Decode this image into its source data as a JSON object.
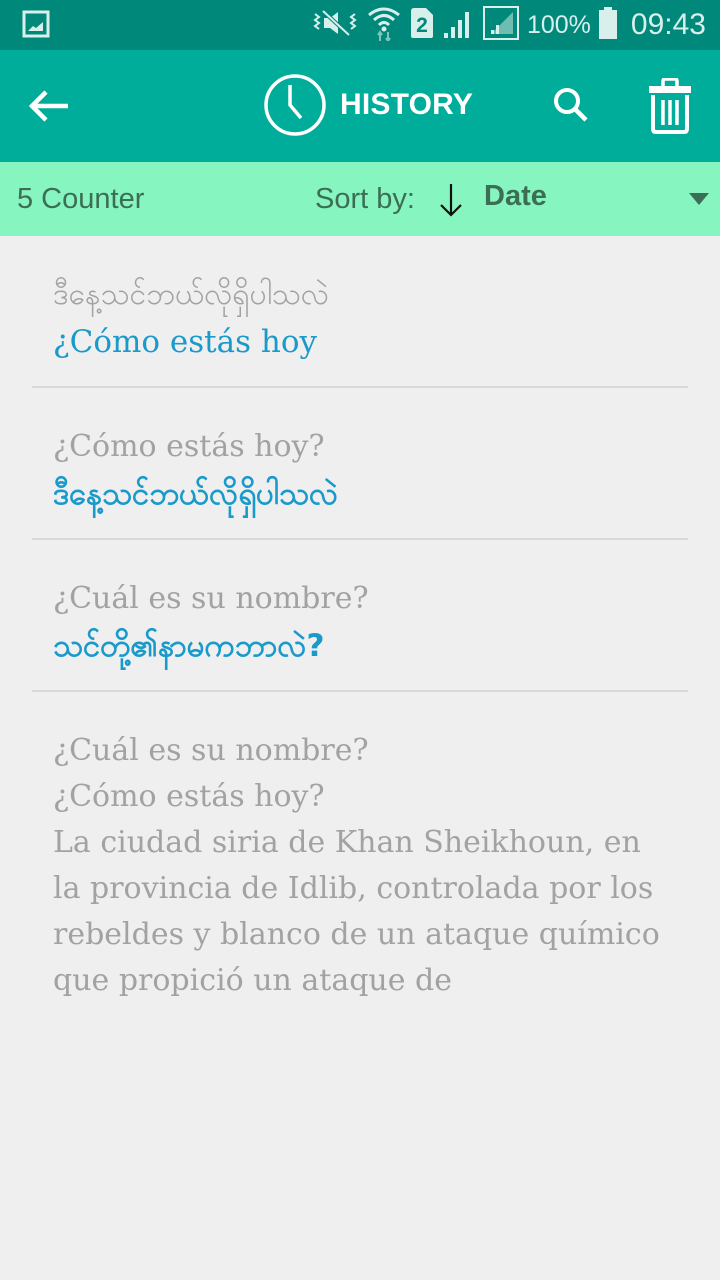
{
  "status_bar": {
    "left_icon": "gallery-notification-icon",
    "icons": [
      "vibrate-mute-icon",
      "wifi-icon",
      "sim-2-icon",
      "signal-icon",
      "signal-2-icon",
      "battery-icon"
    ],
    "battery": "100%",
    "time": "09:43"
  },
  "toolbar": {
    "back_icon": "arrow-left-icon",
    "title_icon": "clock-icon",
    "title": "HISTORY",
    "search_icon": "search-icon",
    "delete_icon": "trash-icon"
  },
  "sortbar": {
    "counter": "5 Counter",
    "sort_label": "Sort by:",
    "sort_direction_icon": "arrow-down-icon",
    "sort_value": "Date",
    "dropdown_icon": "caret-down-icon"
  },
  "colors": {
    "status_bar": "#00897b",
    "toolbar": "#00ad9a",
    "sortbar": "#86f5c0",
    "source_text": "#a2a2a2",
    "translation_text": "#1a9acb"
  },
  "history": [
    {
      "source": "ဒီနေ့သင်ဘယ်လိုရှိပါသလဲ",
      "translation": "¿Cómo estás hoy",
      "source_lang": "my",
      "translation_lang": "es"
    },
    {
      "source": "¿Cómo estás hoy?",
      "translation": "ဒီနေ့သင်ဘယ်လိုရှိပါသလဲ",
      "source_lang": "es",
      "translation_lang": "my"
    },
    {
      "source": "¿Cuál es su nombre?",
      "translation": "သင်တို့၏နာမကဘာလဲ?",
      "source_lang": "es",
      "translation_lang": "my"
    },
    {
      "source": "¿Cuál es su nombre?\n¿Cómo estás hoy?\nLa ciudad siria de Khan Sheikhoun, en la provincia de Idlib, controlada por los rebeldes y blanco de un ataque químico que propició un ataque de",
      "translation": "",
      "source_lang": "es",
      "translation_lang": ""
    }
  ]
}
